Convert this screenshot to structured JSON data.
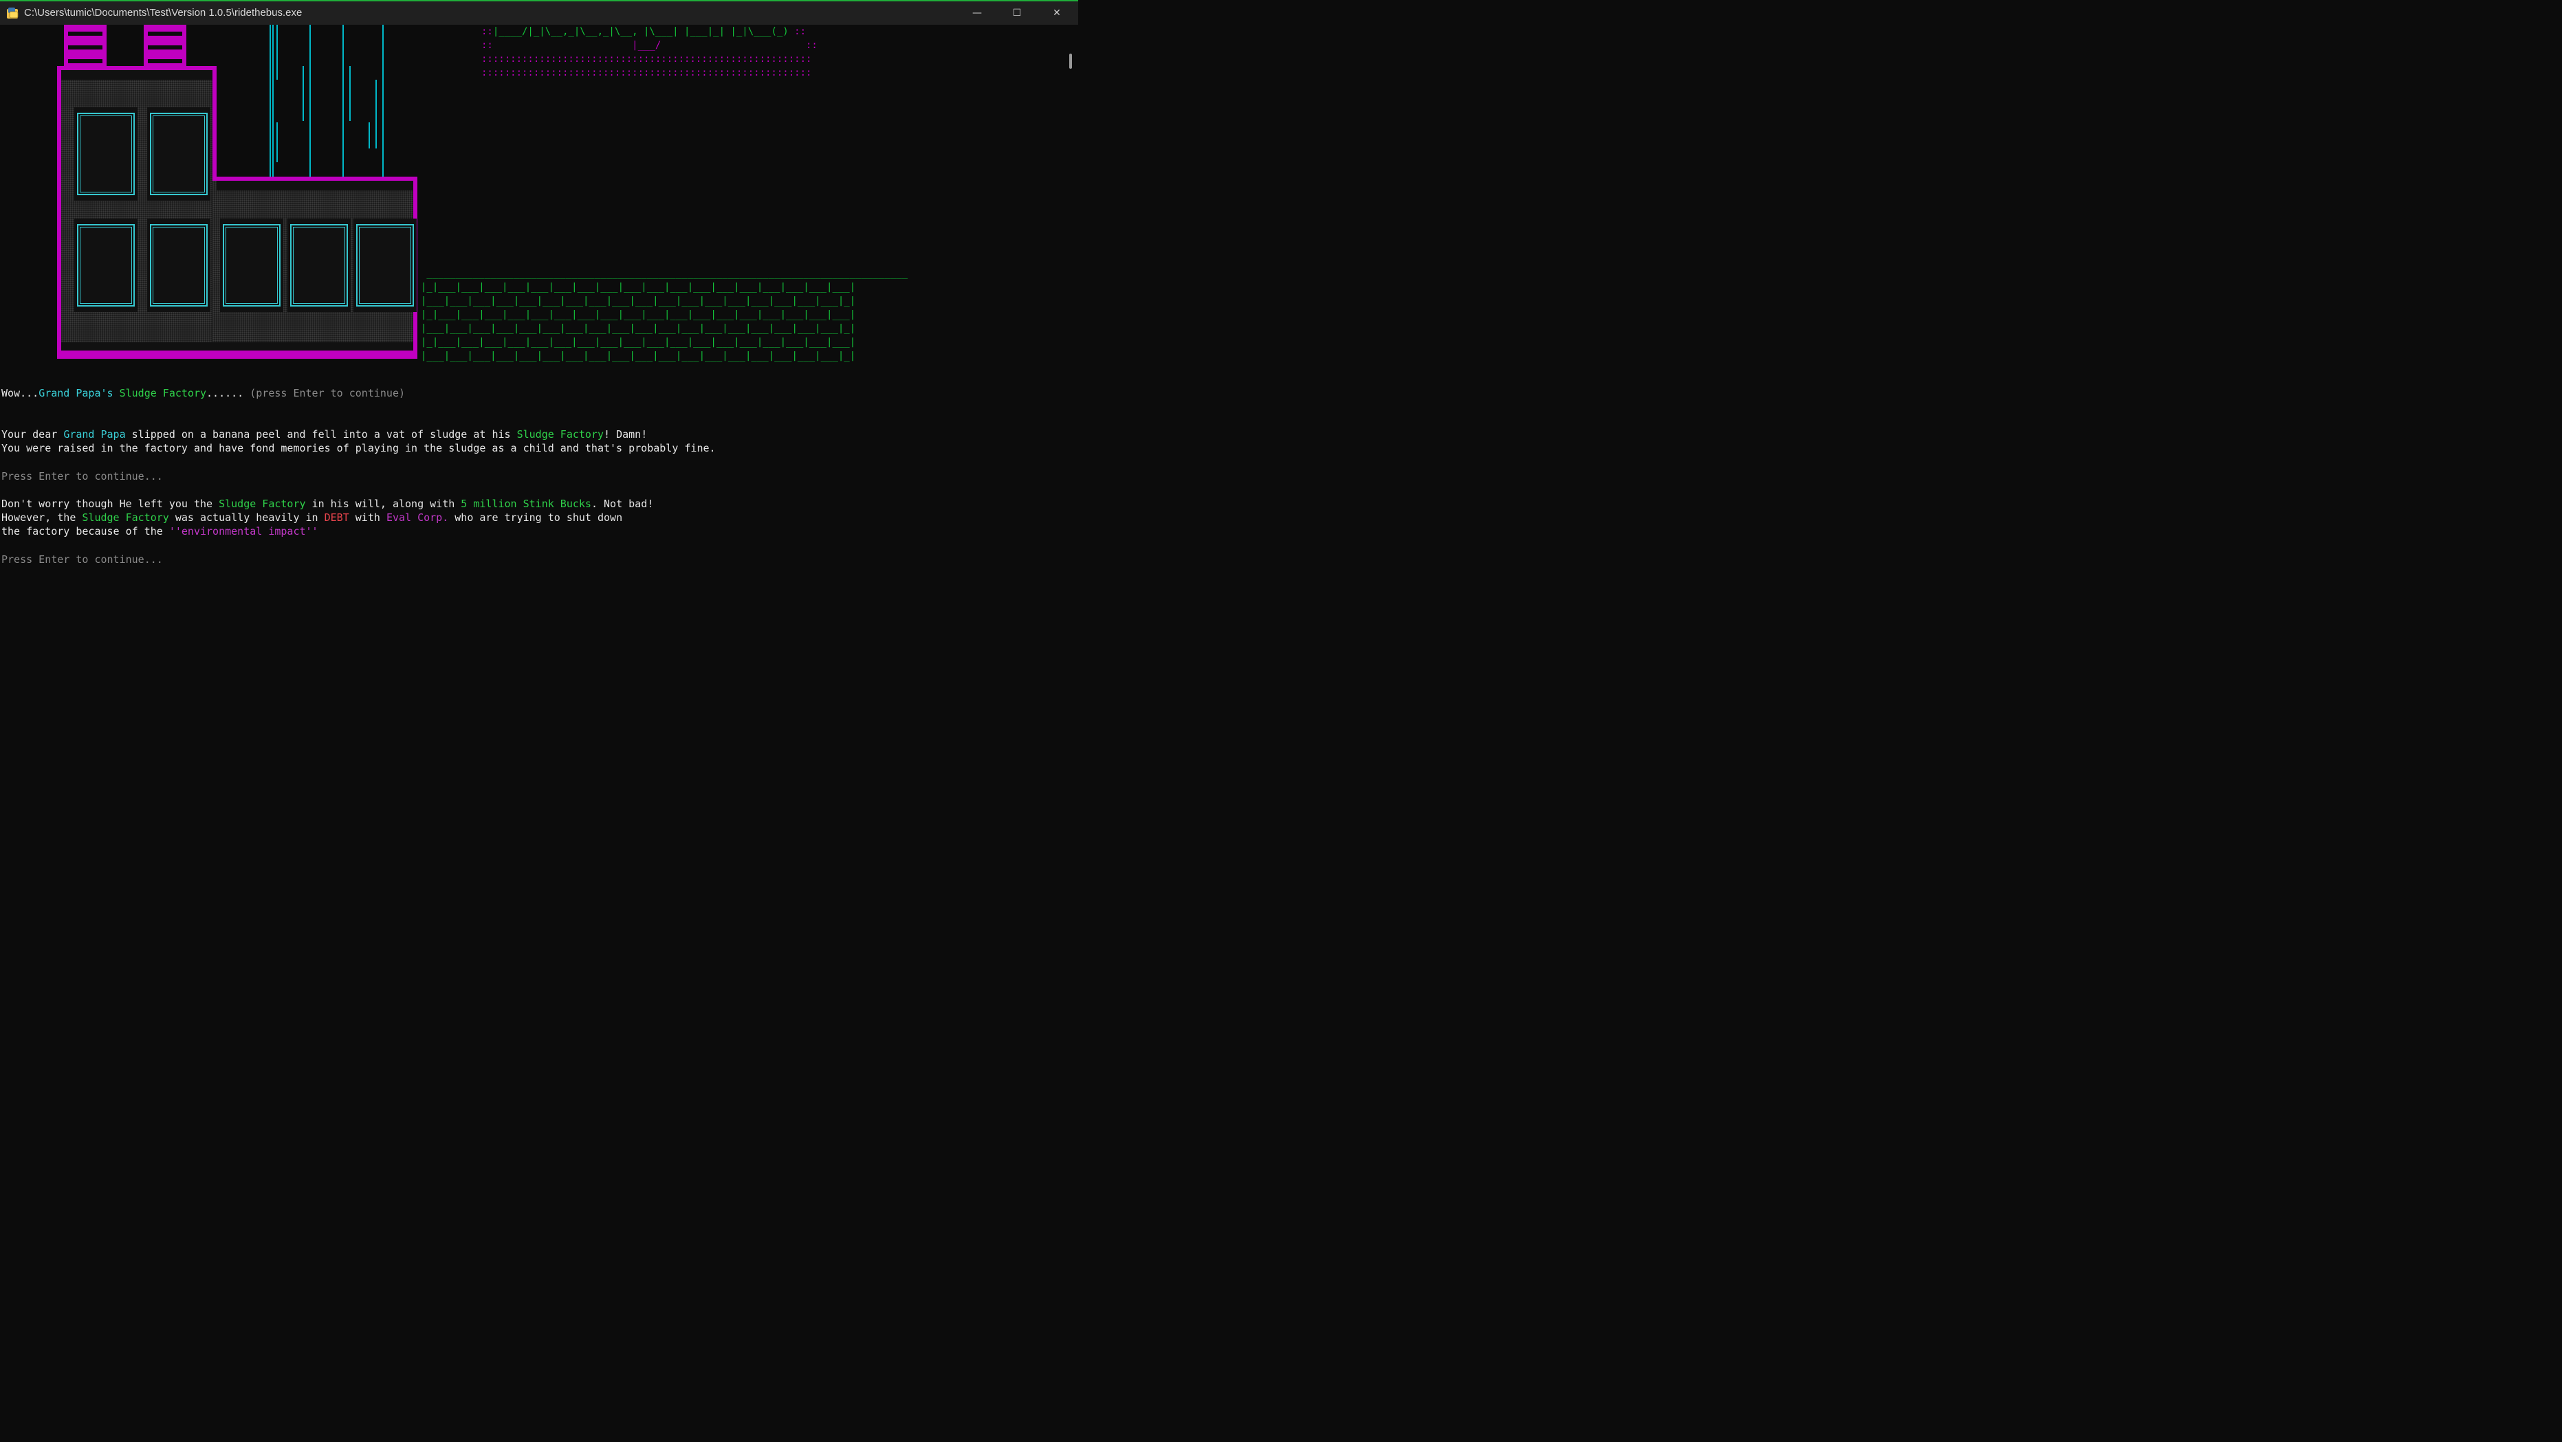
{
  "window": {
    "title": "C:\\Users\\tumic\\Documents\\Test\\Version 1.0.5\\ridethebus.exe",
    "controls": {
      "minimize": "—",
      "maximize": "☐",
      "close": "✕"
    }
  },
  "ascii": {
    "banner_line1_prefix": "::",
    "banner_line1_art": "|____/|_|\\__,_|\\__,_|\\__, |\\___| |___|_| |_|\\___(_)",
    "banner_line1_suffix": "::",
    "banner_line2": "::                        |___/                         ::",
    "banner_line3": ":::::::::::::::::::::::::::::::::::::::::::::::::::::::::",
    "banner_line4": ":::::::::::::::::::::::::::::::::::::::::::::::::::::::::",
    "wall_top": " ___________________________________________________________________________________",
    "wall_row_a": "|_|___|___|___|___|___|___|___|___|___|___|___|___|___|___|___|___|___|___|",
    "wall_row_b": "|___|___|___|___|___|___|___|___|___|___|___|___|___|___|___|___|___|___|_|"
  },
  "line1": {
    "a": "Wow...",
    "b": "Grand Papa's",
    "c": " ",
    "d": "Sludge Factory",
    "e": "......",
    "f": " (press Enter to continue)"
  },
  "para1": {
    "a": "Your dear ",
    "b": "Grand Papa",
    "c": " slipped on a banana peel and fell into a vat of sludge at his ",
    "d": "Sludge Factory",
    "e": "! Damn!",
    "line2": "You were raised in the factory and have fond memories of playing in the sludge as a child and that's probably fine."
  },
  "prompt1": "Press Enter to continue...",
  "para2": {
    "a": "Don't worry though He left you the ",
    "b": "Sludge Factory",
    "c": " in his will, along with ",
    "d": "5 million Stink Bucks",
    "e": ". Not bad!",
    "f": "However, the ",
    "g": "Sludge Factory",
    "h": " was actually heavily in ",
    "i": "DEBT",
    "j": " with ",
    "k": "Eval Corp.",
    "l": " who are trying to shut down",
    "m": "the factory because of the ",
    "n": "''environmental impact''"
  },
  "prompt2": "Press Enter to continue...",
  "colors": {
    "accent_cyan": "#3ad0d8",
    "accent_green": "#2fd04a",
    "accent_magenta": "#c000c0",
    "accent_red": "#e8444c",
    "background": "#0c0c0c"
  }
}
